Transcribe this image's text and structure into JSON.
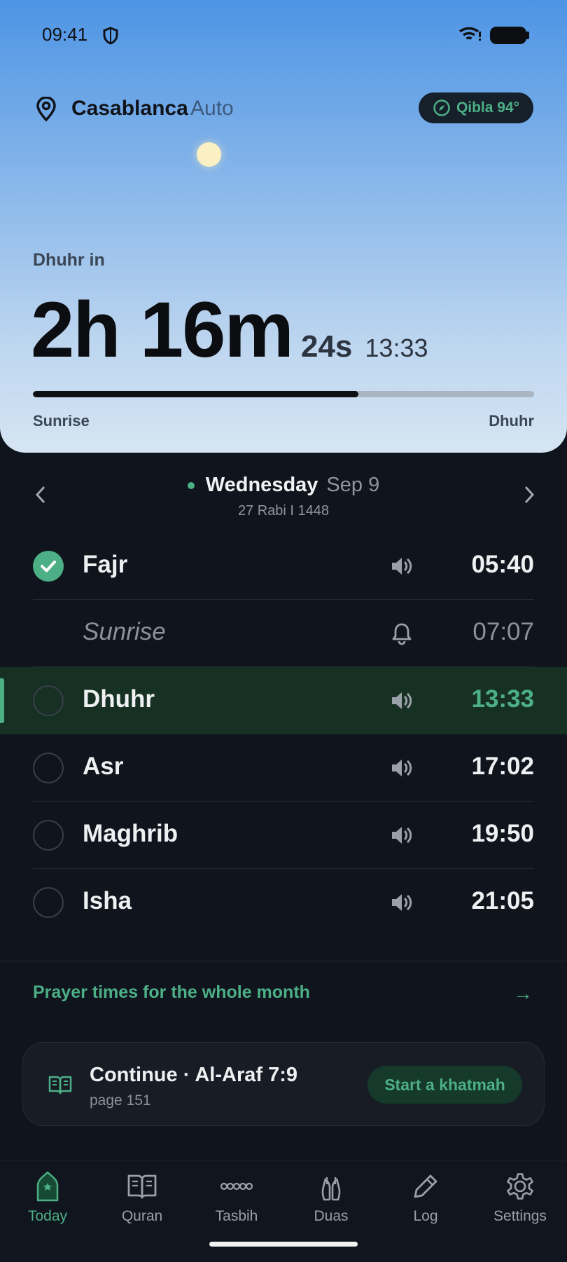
{
  "status_bar": {
    "time": "09:41"
  },
  "location": {
    "city": "Casablanca",
    "mode": "Auto",
    "qibla_label": "Qibla 94°"
  },
  "next_prayer": {
    "label": "Dhuhr in",
    "countdown_main": "2h 16m",
    "countdown_seconds": "24s",
    "at_time": "13:33",
    "progress_fraction": 0.65,
    "progress_start": "Sunrise",
    "progress_end": "Dhuhr"
  },
  "date": {
    "weekday": "Wednesday",
    "gregorian": "Sep 9",
    "hijri": "27 Rabi I 1448"
  },
  "prayers": [
    {
      "name": "Fajr",
      "time": "05:40",
      "done": true,
      "alert": "speaker-icon"
    },
    {
      "name": "Sunrise",
      "time": "07:07",
      "muted": true,
      "alert": "bell-icon"
    },
    {
      "name": "Dhuhr",
      "time": "13:33",
      "active": true,
      "alert": "speaker-icon"
    },
    {
      "name": "Asr",
      "time": "17:02",
      "alert": "speaker-icon"
    },
    {
      "name": "Maghrib",
      "time": "19:50",
      "alert": "speaker-icon"
    },
    {
      "name": "Isha",
      "time": "21:05",
      "alert": "speaker-icon"
    }
  ],
  "month_link": {
    "label": "Prayer times for the whole month",
    "arrow": "→"
  },
  "quran_card": {
    "title": "Continue · Al-Araf 7:9",
    "subtitle": "page 151",
    "button": "Start a khatmah"
  },
  "tabs": [
    {
      "label": "Today",
      "icon": "mosque-icon",
      "selected": true
    },
    {
      "label": "Quran",
      "icon": "book-icon"
    },
    {
      "label": "Tasbih",
      "icon": "beads-icon"
    },
    {
      "label": "Duas",
      "icon": "hands-icon"
    },
    {
      "label": "Log",
      "icon": "pencil-icon"
    },
    {
      "label": "Settings",
      "icon": "gear-icon"
    }
  ],
  "colors": {
    "accent": "#4caf85",
    "background": "#10141c",
    "active_row": "#163123"
  }
}
